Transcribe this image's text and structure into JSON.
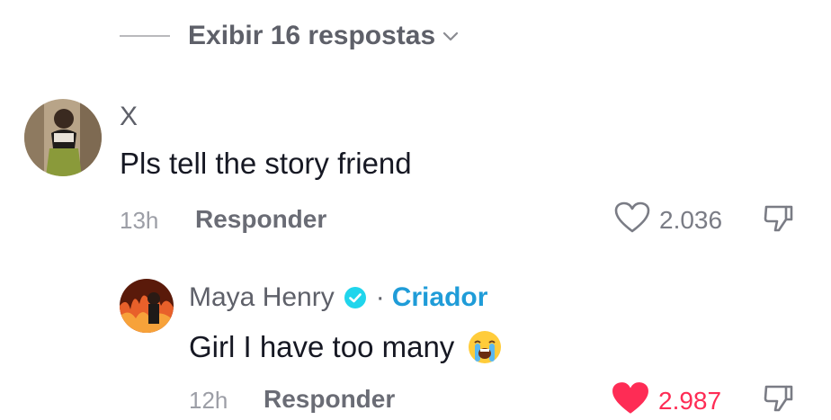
{
  "replies_toggle": {
    "label": "Exibir 16 respostas",
    "icon": "chevron-down-icon"
  },
  "comments": [
    {
      "username": "X",
      "text": "Pls tell the story friend",
      "time": "13h",
      "reply_label": "Responder",
      "likes": "2.036",
      "liked": false,
      "avatar_icon": "user-avatar"
    },
    {
      "username": "Maya Henry",
      "verified": true,
      "separator": "·",
      "badge": "Criador",
      "text": "Girl I have too many",
      "emoji": "loudly-crying-face-icon",
      "time": "12h",
      "reply_label": "Responder",
      "likes": "2.987",
      "liked": true,
      "avatar_icon": "creator-avatar"
    }
  ],
  "colors": {
    "text_primary": "#161823",
    "text_secondary": "#5e6069",
    "liked_red": "#fe2c55",
    "verified_blue": "#20d5ec",
    "creator_blue": "#1f9cd8"
  }
}
